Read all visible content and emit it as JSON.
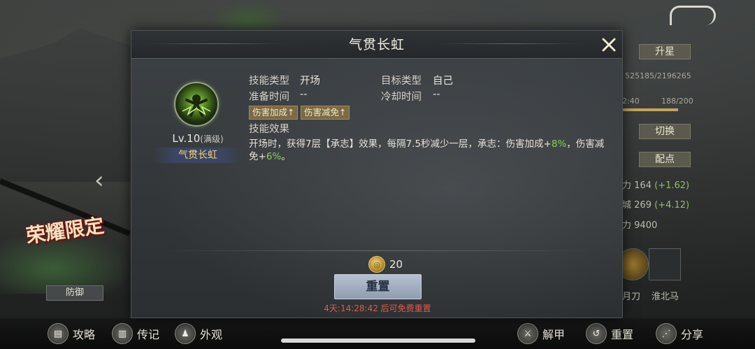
{
  "background": {
    "logo_text": "荣耀限定",
    "defense_button": "防御",
    "left_arrow_icon": "chevron-left-icon",
    "back_icon": "back-arrow-icon"
  },
  "right_panel": {
    "star_up_button": "升星",
    "exp_text": "525185/2196265",
    "time_text": "2:40",
    "stamina_text": "188/200",
    "switch_button": "切换",
    "allocate_button": "配点",
    "stat_1_label": "力",
    "stat_1_value": "164",
    "stat_1_bonus": "(+1.62)",
    "stat_2_label": "城",
    "stat_2_value": "269",
    "stat_2_bonus": "(+4.12)",
    "stat_3_label": "力",
    "stat_3_value": "9400",
    "equip_1_label": "月刀",
    "equip_2_label": "淮北马"
  },
  "toolbar": {
    "items": [
      {
        "label": "攻略",
        "icon": "book-icon"
      },
      {
        "label": "传记",
        "icon": "scroll-icon"
      },
      {
        "label": "外观",
        "icon": "outfit-icon"
      },
      {
        "label": "解甲",
        "icon": "unarmor-icon"
      },
      {
        "label": "重置",
        "icon": "reset-icon"
      },
      {
        "label": "分享",
        "icon": "share-icon"
      }
    ]
  },
  "dialog": {
    "title": "气贯长虹",
    "close_icon": "close-icon",
    "skill": {
      "level": "Lv.10",
      "level_suffix": "(满级)",
      "name": "气贯长虹"
    },
    "info": {
      "skill_type_label": "技能类型",
      "skill_type_value": "开场",
      "target_type_label": "目标类型",
      "target_type_value": "自己",
      "prep_time_label": "准备时间",
      "prep_time_value": "--",
      "cooldown_label": "冷却时间",
      "cooldown_value": "--",
      "tags": [
        "伤害加成↑",
        "伤害减免↑"
      ],
      "effect_label": "技能效果",
      "effect_text_1": "开场时，获得7层【承志】效果，每隔7.5秒减少一层，承志：伤害加成+",
      "effect_pct_1": "8%",
      "effect_text_2": "，伤害减免+",
      "effect_pct_2": "6%",
      "effect_text_3": "。"
    },
    "cost": {
      "coin_icon": "coin-icon",
      "amount": "20"
    },
    "reset_button": "重置",
    "reset_hint": "4天:14:28:42 后可免费重置"
  },
  "colors": {
    "accent_gold": "#f0d47a",
    "highlight_green": "#8fcf5a",
    "hint_red": "#e05a4a",
    "button_blue": "#b6c1d0"
  }
}
